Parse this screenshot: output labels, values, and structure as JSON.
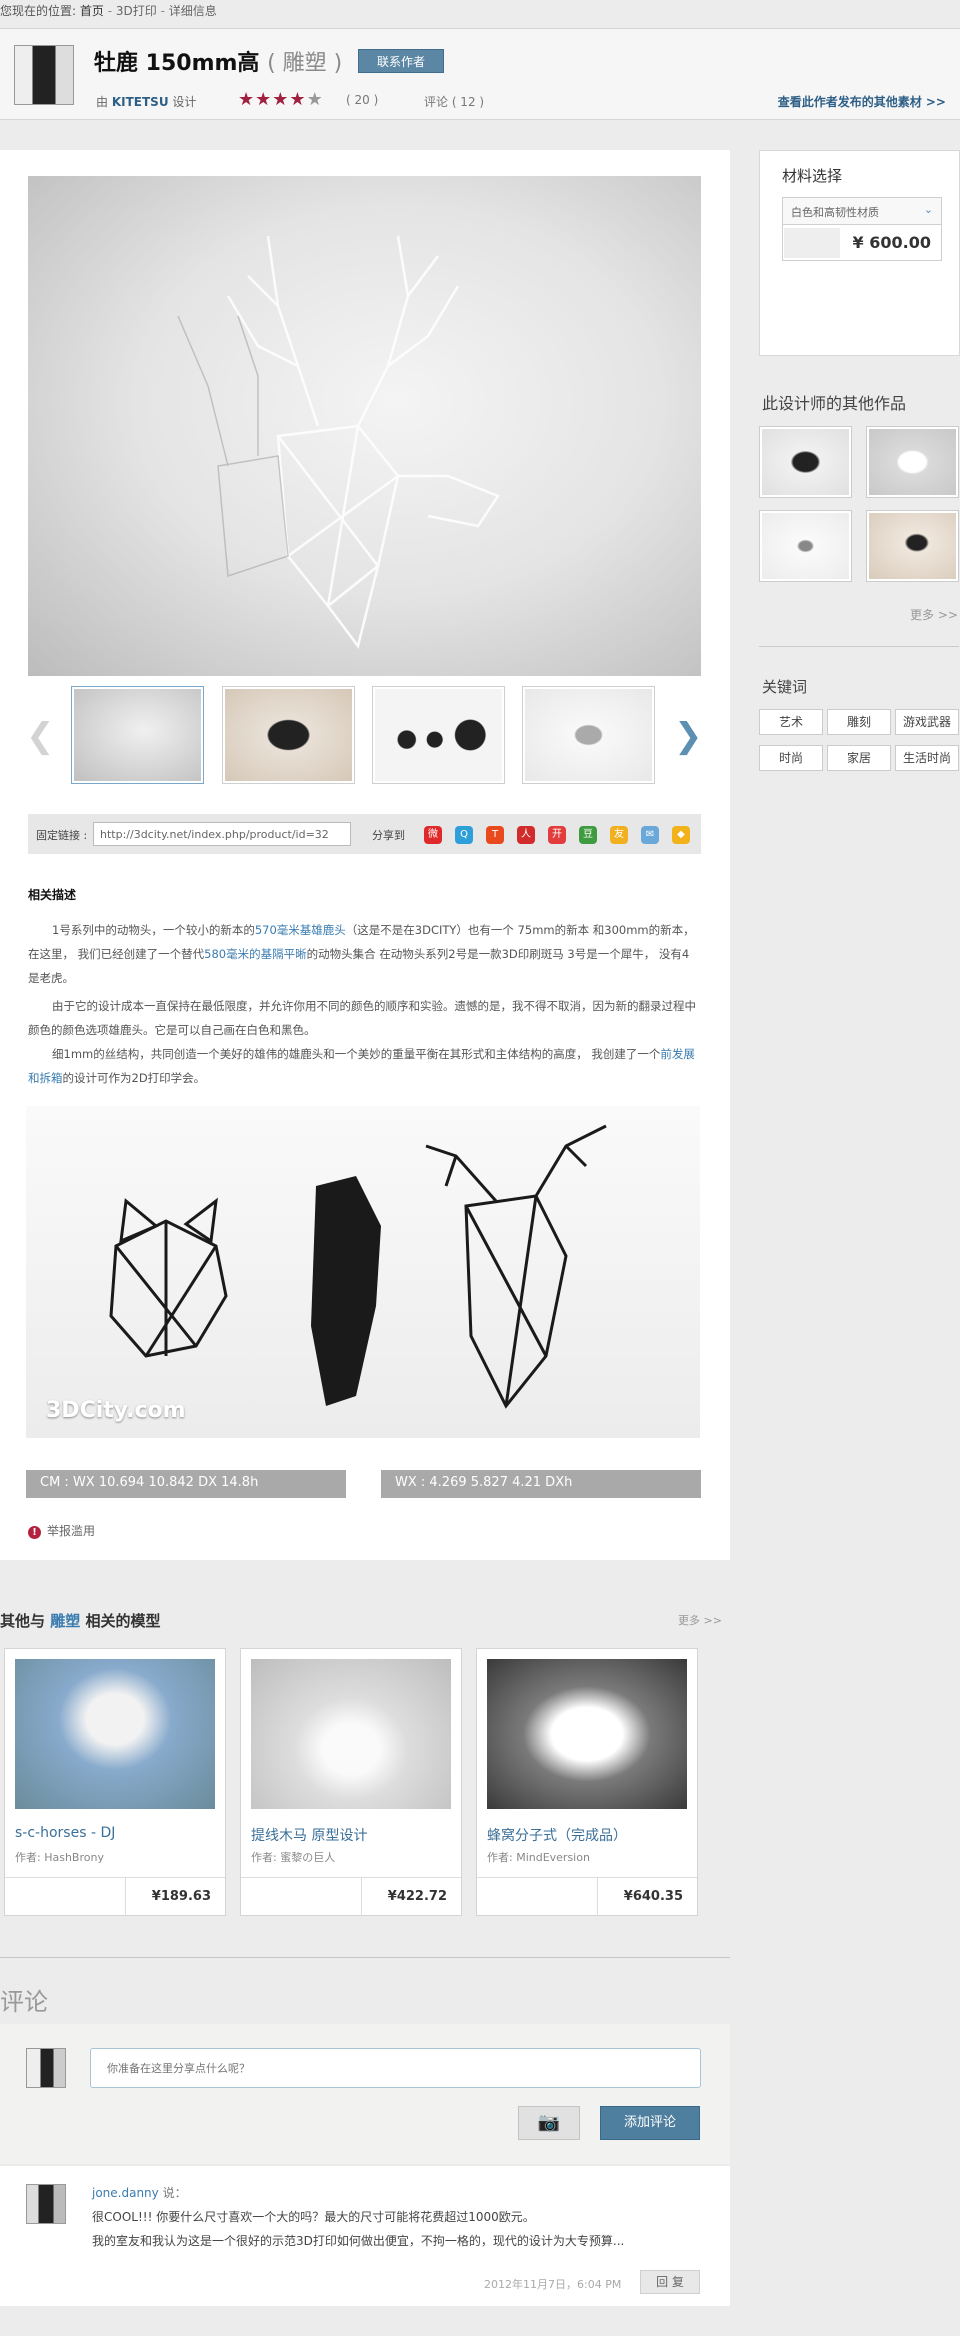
{
  "breadcrumb": {
    "prefix": "您现在的位置:",
    "home": "首页",
    "sep1": " - ",
    "section": "3D打印",
    "sep2": " - ",
    "current": "详细信息"
  },
  "header": {
    "title": "牡鹿  150mm高",
    "category": "( 雕塑 )",
    "contact_button": "联系作者",
    "by_prefix": "由",
    "author": "KITETSU",
    "by_suffix": "设计",
    "rating_stars": 4,
    "rating_count": "( 20 )",
    "comment_count": "评论 ( 12 )",
    "more_from_author": "查看此作者发布的其他素材 >>"
  },
  "gallery": {
    "prev_arrow": "❮",
    "next_arrow": "❯"
  },
  "link_bar": {
    "label": "固定链接 :",
    "url": "http://3dcity.net/index.php/product/id=32",
    "share_label": "分享到",
    "share_icons": [
      "weibo-icon",
      "qzone-icon",
      "tencent-icon",
      "renren-icon",
      "kaixin-icon",
      "douban-icon",
      "pengyou-icon",
      "mail-icon",
      "tag-icon"
    ]
  },
  "description": {
    "heading": "相关描述",
    "p1_a": "1号系列中的动物头，一个较小的新本的",
    "p1_link1": "570毫米基雄鹿头",
    "p1_b": "（这是不是在3DCITY）也有一个 75mm的新本 和300mm的新本，在这里，  我们已经创建了一个替代",
    "p1_link2": "580毫米的基隔平晰",
    "p1_c": "的动物头集合 在动物头系列2号是一款3D印刷斑马   3号是一个犀牛，   没有4是老虎。",
    "p2": "由于它的设计成本一直保持在最低限度，并允许你用不同的颜色的顺序和实验。遗憾的是，我不得不取消，因为新的翻录过程中颜色的颜色选项雄鹿头。它是可以自己画在白色和黑色。",
    "p3_a": "细1mm的丝结构，共同创造一个美好的雄伟的雄鹿头和一个美妙的重量平衡在其形式和主体结构的高度， 我创建了一个",
    "p3_link": "前发展和拆箱",
    "p3_b": "的设计可作为2D打印学会。"
  },
  "banner": {
    "logo": "3DCity.com"
  },
  "specs": {
    "left": "CM :  WX 10.694 10.842 DX 14.8h",
    "right": "WX :  4.269 5.827 4.21 DXh"
  },
  "report": {
    "icon": "!",
    "label": "举报滥用"
  },
  "material": {
    "title": "材料选择",
    "selected": "白色和高韧性材质",
    "price": "¥ 600.00"
  },
  "sidebar": {
    "other_works_title": "此设计师的其他作品",
    "more": "更多 >>",
    "keywords_title": "关键词",
    "keywords": [
      "艺术",
      "雕刻",
      "游戏武器",
      "时尚",
      "家居",
      "生活时尚"
    ]
  },
  "related": {
    "title_prefix": "其他与",
    "title_link": "雕塑",
    "title_suffix": "相关的模型",
    "more": "更多 >>",
    "cards": [
      {
        "name": "s-c-horses - DJ",
        "author": "作者: HashBrony",
        "price": "¥189.63"
      },
      {
        "name": "提线木马 原型设计",
        "author": "作者: 蜜黎の巨人",
        "price": "¥422.72"
      },
      {
        "name": "蜂窝分子式（完成品）",
        "author": "作者: MindEversion",
        "price": "¥640.35"
      }
    ]
  },
  "comments": {
    "title": "评论",
    "placeholder": "你准备在这里分享点什么呢？",
    "camera_icon": "camera-icon",
    "add_button": "添加评论",
    "items": [
      {
        "user": "jone.danny",
        "says": " 说：",
        "line1": "很COOL!!!   你要什么尺寸喜欢一个大的吗？最大的尺寸可能将花费超过1000欧元。",
        "line2": "我的室友和我认为这是一个很好的示范3D打印如何做出便宜，不拘一格的，现代的设计为大专预算...",
        "time": "2012年11月7日，6:04 PM",
        "reply": "回 复"
      }
    ]
  },
  "colors": {
    "accent": "#3a7cb0",
    "button": "#4f7f9f",
    "star": "#a02040",
    "report": "#b3213e"
  }
}
